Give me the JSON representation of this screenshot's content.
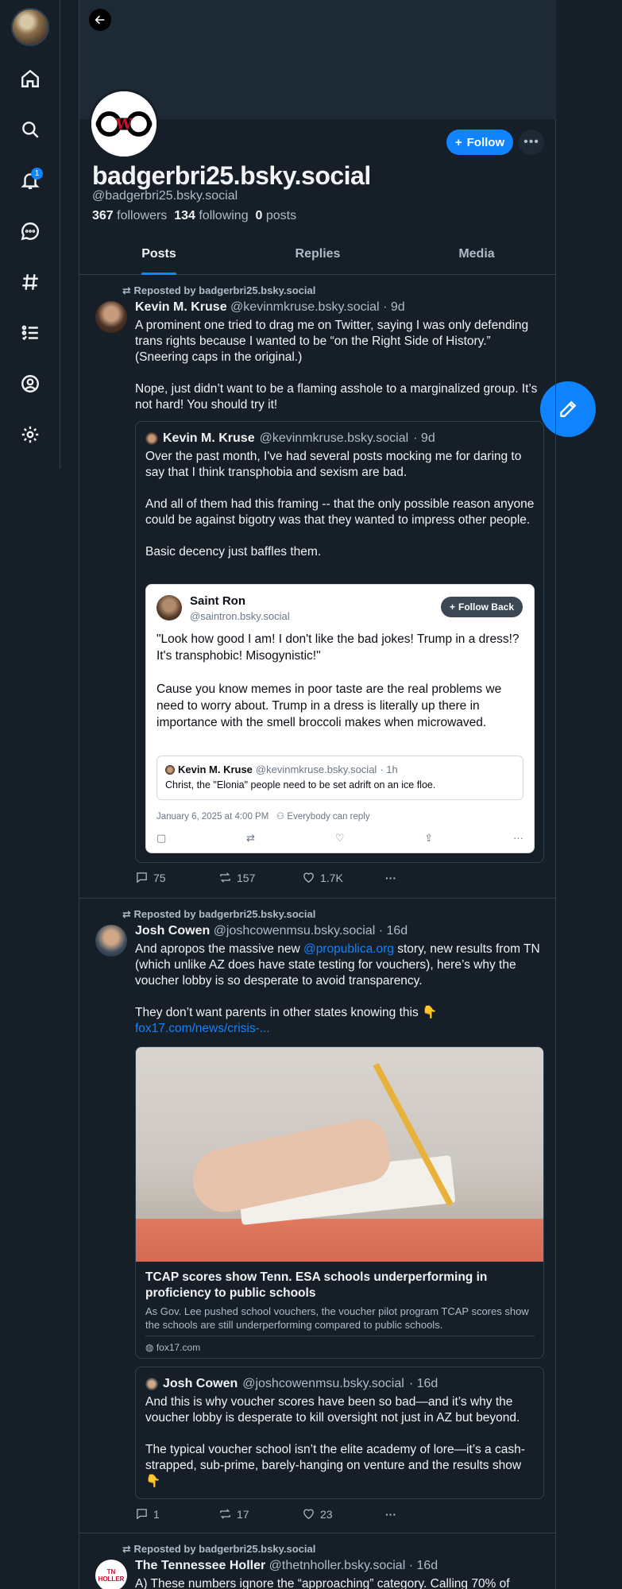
{
  "nav": {
    "notification_count": "1"
  },
  "profile": {
    "display_name": "badgerbri25.bsky.social",
    "handle": "@badgerbri25.bsky.social",
    "followers_count": "367",
    "followers_label": "followers",
    "following_count": "134",
    "following_label": "following",
    "posts_count": "0",
    "posts_label": "posts",
    "follow_label": "Follow"
  },
  "tabs": [
    {
      "label": "Posts"
    },
    {
      "label": "Replies"
    },
    {
      "label": "Media"
    }
  ],
  "posts": [
    {
      "repost_label": "Reposted by badgerbri25.bsky.social",
      "author": "Kevin M. Kruse",
      "handle": "@kevinmkruse.bsky.social",
      "time": "· 9d",
      "text": "A prominent one tried to drag me on Twitter, saying I was only defending trans rights because I wanted to be “on the Right Side of History.” (Sneering caps in the original.)\n\nNope, just didn’t want to be a flaming asshole to a marginalized group. It’s not hard! You should try it!",
      "quote": {
        "author": "Kevin M. Kruse",
        "handle": "@kevinmkruse.bsky.social",
        "time": "· 9d",
        "text": "Over the past month, I've had several posts mocking me for daring to say that I think transphobia and sexism are bad.\n\nAnd all of them had this framing -- that the only possible reason anyone could be against bigotry was that they wanted to impress other people.\n\nBasic decency just baffles them.",
        "screenshot": {
          "author": "Saint Ron",
          "handle": "@saintron.bsky.social",
          "follow_back": "Follow Back",
          "text": "\"Look how good I am! I don't like the bad jokes! Trump in a dress!? It's transphobic! Misogynistic!\"\n\nCause you know memes in poor taste are the real problems we need to worry about. Trump in a dress is literally up there in importance with the smell broccoli makes when microwaved.",
          "inner_author": "Kevin M. Kruse",
          "inner_handle": "@kevinmkruse.bsky.social",
          "inner_time": "· 1h",
          "inner_text": "Christ, the \"Elonia\" people need to be set adrift on an ice floe.",
          "date": "January 6, 2025 at 4:00 PM",
          "reply_setting": "Everybody can reply"
        }
      },
      "replies": "75",
      "reposts": "157",
      "likes": "1.7K"
    },
    {
      "repost_label": "Reposted by badgerbri25.bsky.social",
      "author": "Josh Cowen",
      "handle": "@joshcowenmsu.bsky.social",
      "time": "· 16d",
      "text_before_mention": "And apropos the massive new ",
      "mention": "@propublica.org",
      "text_after_mention": " story, new results from TN (which unlike AZ does have state testing for vouchers), here’s why the voucher lobby is so desperate to avoid transparency.\n\nThey don’t want parents in other states knowing this 👇",
      "link": "fox17.com/news/crisis-...",
      "card": {
        "title": "TCAP scores show Tenn. ESA schools underperforming in proficiency to public schools",
        "description": "As Gov. Lee pushed school vouchers, the voucher pilot program TCAP scores show the schools are still underperforming compared to public schools.",
        "domain": "fox17.com"
      },
      "quote": {
        "author": "Josh Cowen",
        "handle": "@joshcowenmsu.bsky.social",
        "time": "· 16d",
        "text": "And this is why voucher scores have been so bad—and it’s why the voucher lobby is desperate to kill oversight not just in AZ but beyond.\n\nThe typical voucher school isn’t the elite academy of lore—it’s a cash-strapped, sub-prime, barely-hanging on venture and the results show 👇"
      },
      "replies": "1",
      "reposts": "17",
      "likes": "23"
    },
    {
      "repost_label": "Reposted by badgerbri25.bsky.social",
      "author": "The Tennessee Holler",
      "handle": "@thetnholler.bsky.social",
      "time": "· 16d",
      "avatar_text": "TN HOLLER",
      "text": "A) These numbers ignore the “approaching” category. Calling 70% of"
    }
  ]
}
